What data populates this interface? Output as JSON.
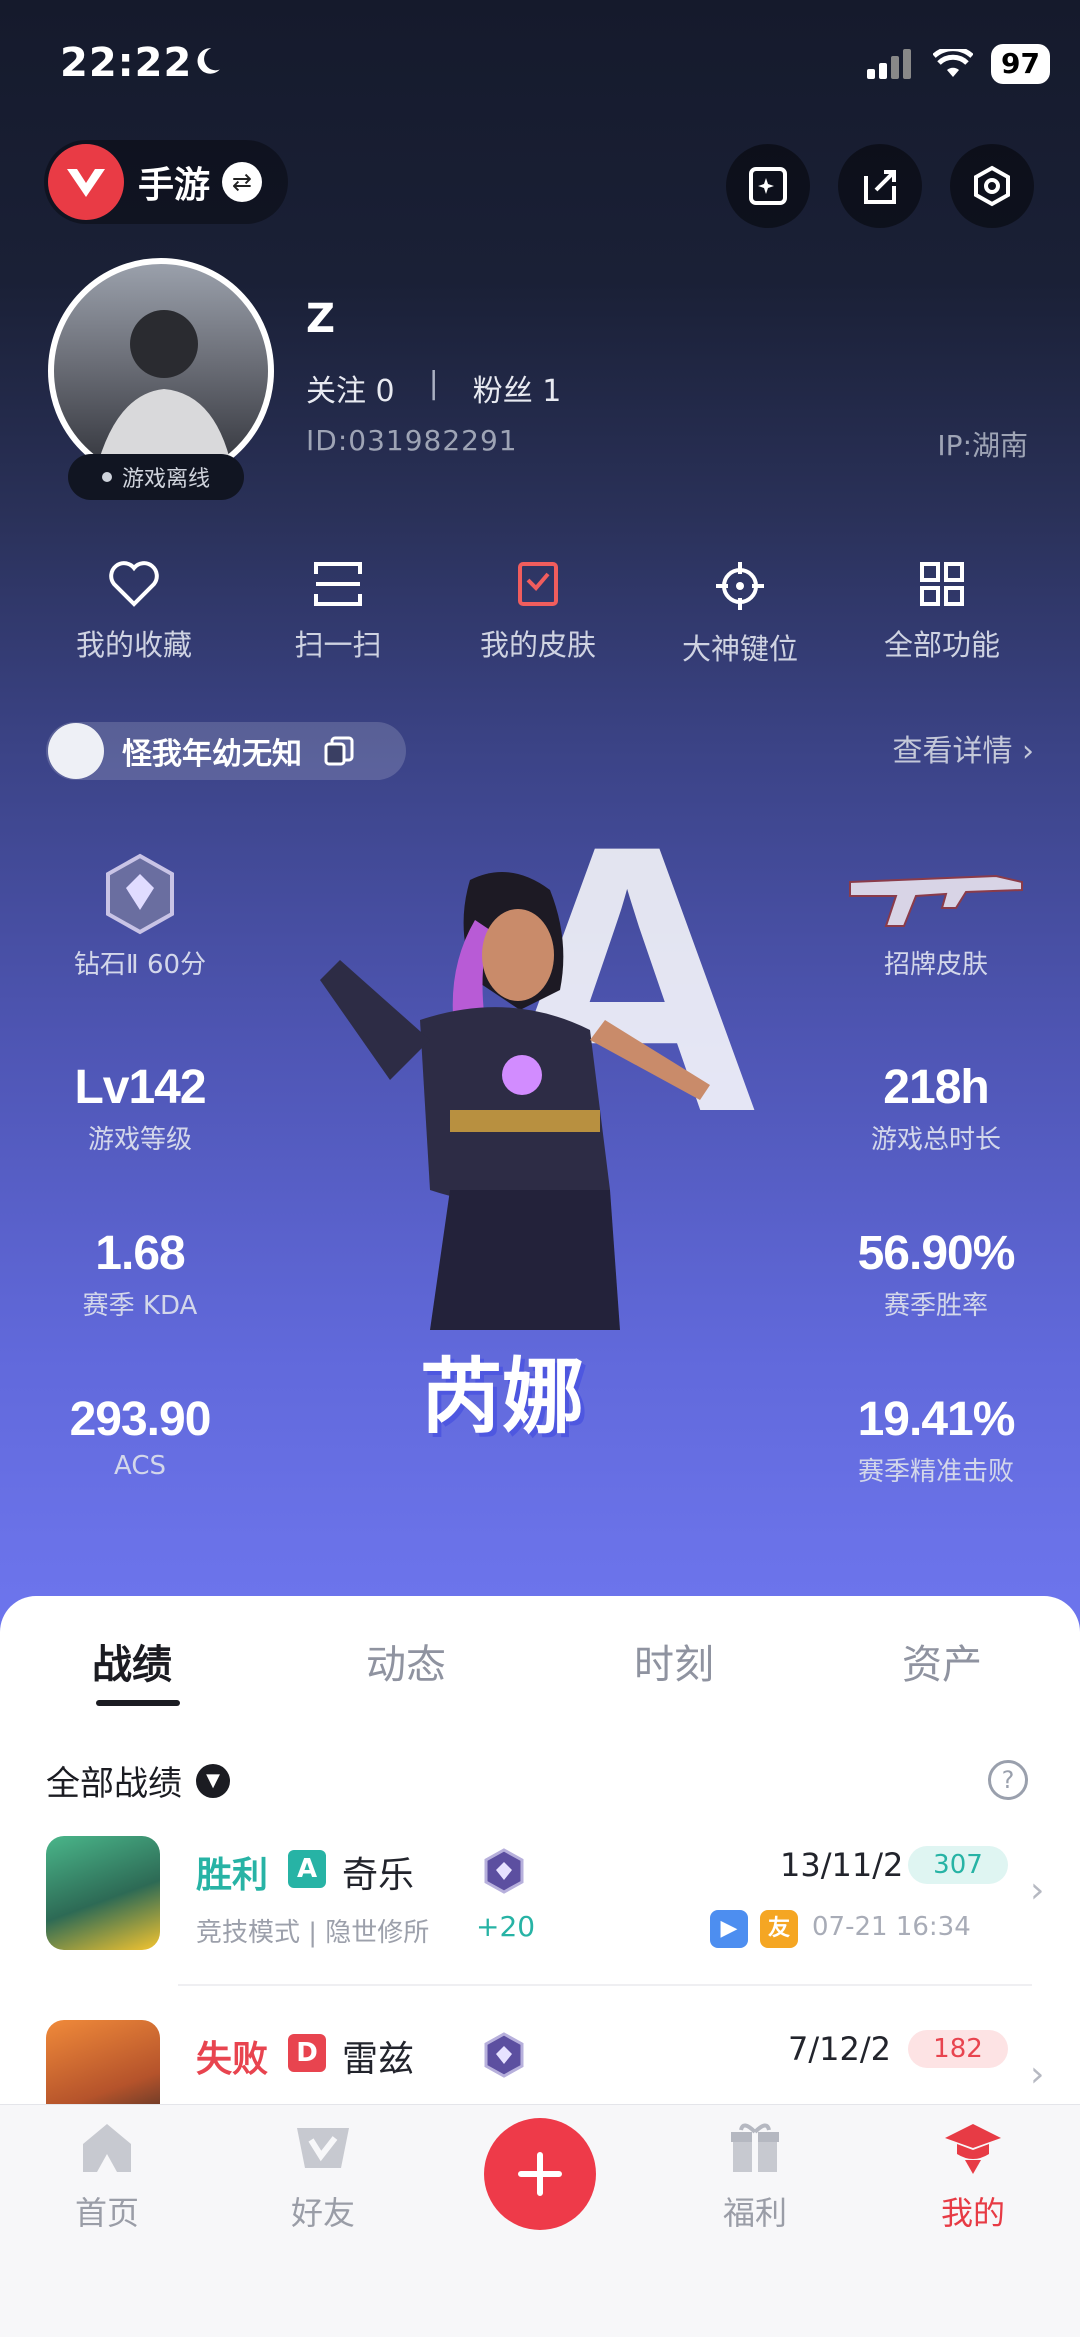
{
  "status": {
    "time": "22:22",
    "battery": "97"
  },
  "header": {
    "mode_label": "手游"
  },
  "profile": {
    "username": "Z",
    "following": "关注 0",
    "separator": "|",
    "fans": "粉丝 1",
    "id": "ID:031982291",
    "ip": "IP:湖南",
    "status_badge": "游戏离线"
  },
  "quick_actions": [
    {
      "label": "我的收藏",
      "icon": "heart-icon"
    },
    {
      "label": "扫一扫",
      "icon": "scan-icon"
    },
    {
      "label": "我的皮肤",
      "icon": "skin-icon"
    },
    {
      "label": "大神键位",
      "icon": "crosshair-icon"
    },
    {
      "label": "全部功能",
      "icon": "grid-icon"
    }
  ],
  "game_character": {
    "name": "怪我年幼无知",
    "detail_link": "查看详情 ›"
  },
  "stats": {
    "rank": {
      "label": "钻石Ⅱ 60分"
    },
    "signature_skin": {
      "label": "招牌皮肤"
    },
    "level": {
      "value": "Lv142",
      "label": "游戏等级"
    },
    "playtime": {
      "value": "218h",
      "label": "游戏总时长"
    },
    "kda": {
      "value": "1.68",
      "label": "赛季 KDA"
    },
    "winrate": {
      "value": "56.90%",
      "label": "赛季胜率"
    },
    "acs": {
      "value": "293.90",
      "label": "ACS"
    },
    "headshot": {
      "value": "19.41%",
      "label": "赛季精准击败"
    }
  },
  "hero": {
    "name": "芮娜",
    "background_letter": "A"
  },
  "tabs": [
    {
      "label": "战绩",
      "active": true
    },
    {
      "label": "动态",
      "active": false
    },
    {
      "label": "时刻",
      "active": false
    },
    {
      "label": "资产",
      "active": false
    }
  ],
  "records": {
    "filter": "全部战绩",
    "help": "?",
    "matches": [
      {
        "result": "胜利",
        "rank_letter": "A",
        "agent": "奇乐",
        "mode": "竞技模式 | 隐世修所",
        "rank_change": "+20",
        "score": "13/11/2",
        "acs": "307",
        "tag": "友",
        "time": "07-21 16:34"
      },
      {
        "result": "失败",
        "rank_letter": "D",
        "agent": "雷兹",
        "score": "7/12/2",
        "acs": "182"
      }
    ]
  },
  "bottom_nav": [
    {
      "label": "首页",
      "active": false
    },
    {
      "label": "好友",
      "active": false
    },
    {
      "label": "福利",
      "active": false
    },
    {
      "label": "我的",
      "active": true
    }
  ],
  "colors": {
    "accent": "#ee3a49",
    "win": "#27b3a5",
    "loss": "#e8444f"
  }
}
